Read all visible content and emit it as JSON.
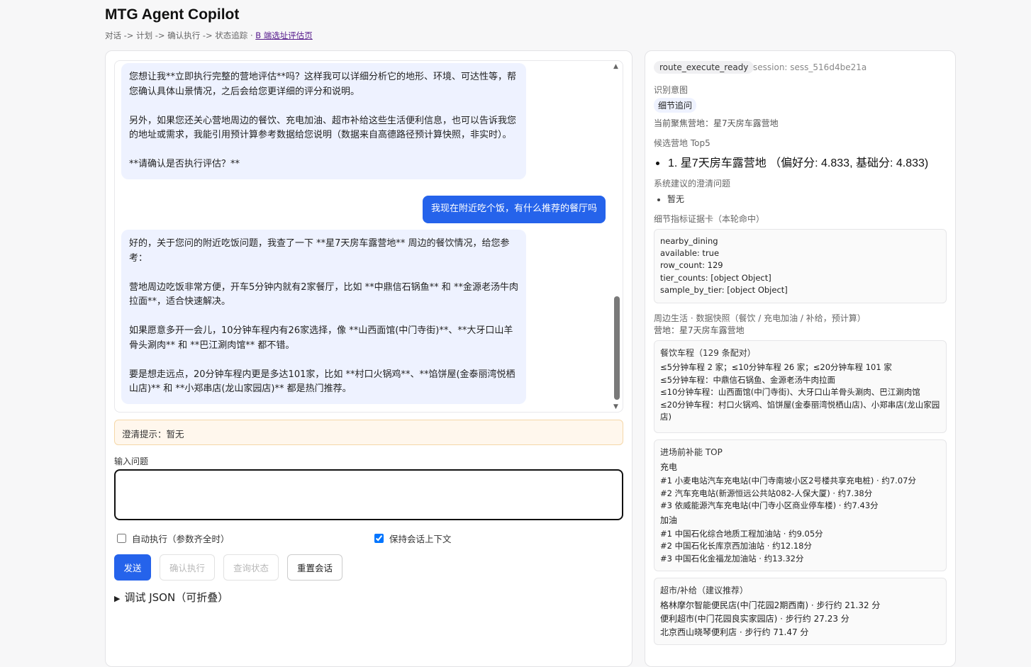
{
  "header": {
    "title": "MTG Agent Copilot",
    "subtitle": "对话 -> 计划 -> 确认执行 -> 状态追踪 · ",
    "link": "B 端选址评估页"
  },
  "chat": {
    "msg1": [
      "您想让我**立即执行完整的营地评估**吗？这样我可以详细分析它的地形、环境、可达性等，帮您确认具体山景情况，之后会给您更详细的评分和说明。",
      "另外，如果您还关心营地周边的餐饮、充电加油、超市补给这些生活便利信息，也可以告诉我您的地址或需求，我能引用预计算参考数据给您说明（数据来自高德路径预计算快照，非实时）。",
      "**请确认是否执行评估？**"
    ],
    "user_msg": "我现在附近吃个饭，有什么推荐的餐厅吗",
    "msg2": [
      "好的，关于您问的附近吃饭问题，我查了一下 **星7天房车露营地** 周边的餐饮情况，给您参考：",
      "营地周边吃饭非常方便，开车5分钟内就有2家餐厅，比如 **中鼎信石锅鱼** 和 **金源老汤牛肉拉面**，适合快速解决。",
      "如果愿意多开一会儿，10分钟车程内有26家选择，像 **山西面馆(中门寺街)**、**大牙口山羊骨头涮肉** 和 **巴江涮肉馆** 都不错。",
      "要是想走远点，20分钟车程内更是多达101家，比如 **村口火锅鸡**、**馅饼屋(金泰丽湾悦栖山店)** 和 **小郑串店(龙山家园店)** 都是热门推荐。"
    ]
  },
  "clarify": "澄清提示：暂无",
  "input": {
    "label": "输入问题",
    "value": "",
    "placeholder": ""
  },
  "options": {
    "auto_exec": "自动执行（参数齐全时）",
    "auto_exec_checked": false,
    "keep_context": "保持会话上下文",
    "keep_context_checked": true
  },
  "buttons": {
    "send": "发送",
    "confirm": "确认执行",
    "query": "查询状态",
    "reset": "重置会话"
  },
  "debug": "调试 JSON（可折叠）",
  "right": {
    "status": "route_execute_ready",
    "session": "session: sess_516d4be21a",
    "intent_label": "识别意图",
    "intent": "细节追问",
    "focus": "当前聚焦营地：星7天房车露营地",
    "top5_label": "候选营地 Top5",
    "top5": [
      "1. 星7天房车露营地 （偏好分: 4.833, 基础分: 4.833)"
    ],
    "clarify_label": "系统建议的澄清问题",
    "clarify_items": [
      "暂无"
    ],
    "evidence_label": "细节指标证据卡（本轮命中）",
    "evidence": [
      "nearby_dining",
      "available: true",
      "row_count: 129",
      "tier_counts: [object Object]",
      "sample_by_tier: [object Object]"
    ],
    "life_label": "周边生活 · 数据快照（餐饮 / 充电加油 / 补给，预计算）",
    "life_camp": "营地：星7天房车露营地",
    "dining": {
      "head": "餐饮车程（129 条配对）",
      "lines": [
        "≤5分钟车程 2 家；≤10分钟车程 26 家；≤20分钟车程 101 家",
        "≤5分钟车程：中鼎信石锅鱼、金源老汤牛肉拉面",
        "≤10分钟车程：山西面馆(中门寺街)、大牙口山羊骨头涮肉、巴江涮肉馆",
        "≤20分钟车程：村口火锅鸡、馅饼屋(金泰丽湾悦栖山店)、小郑串店(龙山家园店)"
      ]
    },
    "energy": {
      "head": "进场前补能 TOP",
      "charge_label": "充电",
      "charge": [
        "#1 小麦电站汽车充电站(中门寺南坡小区2号楼共享充电桩) · 约7.07分",
        "#2 汽车充电站(新源恒远公共站082-人保大厦) · 约7.38分",
        "#3 依威能源汽车充电站(中门寺小区商业停车楼) · 约7.43分"
      ],
      "fuel_label": "加油",
      "fuel": [
        "#1 中国石化综合地质工程加油站 · 约9.05分",
        "#2 中国石化长库京西加油站 · 约12.18分",
        "#3 中国石化金福龙加油站 · 约13.32分"
      ]
    },
    "market": {
      "head": "超市/补给（建议推荐）",
      "lines": [
        "格林摩尔智能便民店(中门花园2期西南) · 步行约 21.32 分",
        "便利超市(中门花园良实家园店) · 步行约 27.23 分",
        "北京西山晓琴便利店 · 步行约 71.47 分"
      ]
    }
  }
}
